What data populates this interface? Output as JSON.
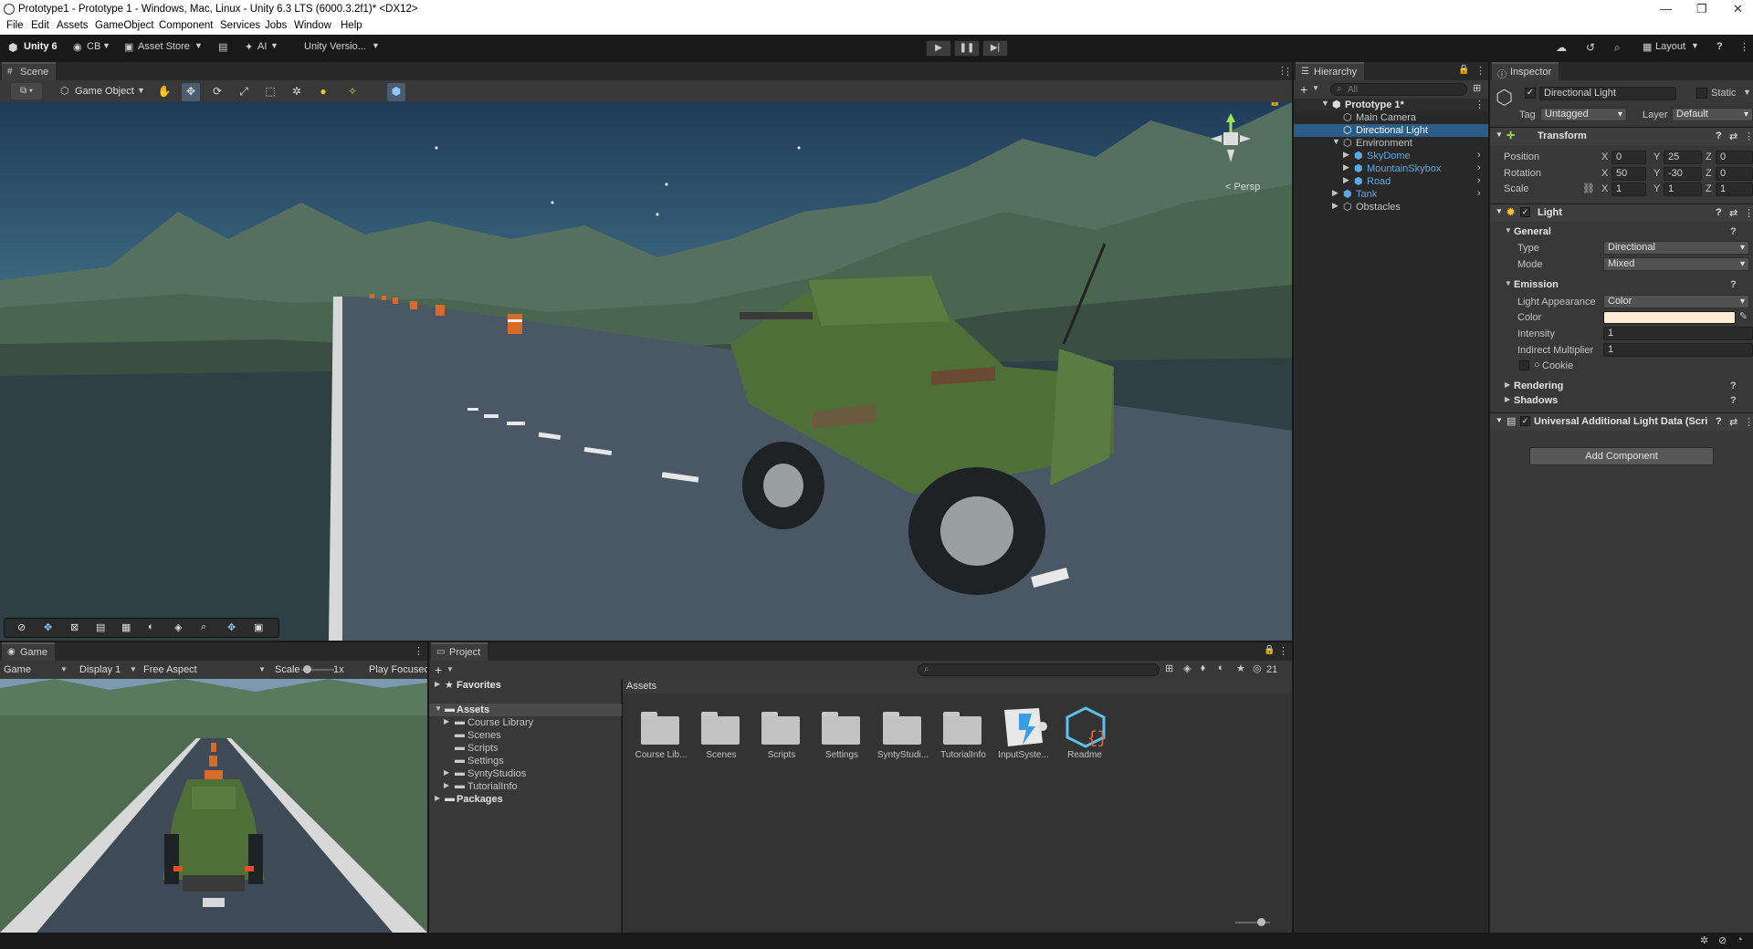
{
  "window": {
    "title": "Prototype1 - Prototype 1 - Windows, Mac, Linux - Unity 6.3 LTS (6000.3.2f1)* <DX12>",
    "controls": [
      "—",
      "❐",
      "✕"
    ]
  },
  "menu": [
    "File",
    "Edit",
    "Assets",
    "GameObject",
    "Component",
    "Services",
    "Jobs",
    "Window",
    "Help"
  ],
  "toolbar": {
    "unity_label": "Unity 6",
    "account": "CB",
    "asset_store": "Asset Store",
    "ai": "AI",
    "version": "Unity Versio...",
    "layout": "Layout"
  },
  "scene": {
    "tab": "Scene",
    "gameobject_dropdown": "Game Object",
    "persp": "< Persp"
  },
  "game": {
    "tab": "Game",
    "mode": "Game",
    "display": "Display 1",
    "aspect": "Free Aspect",
    "scale_label": "Scale",
    "scale_value": "1x",
    "play_focused": "Play Focusec"
  },
  "hierarchy": {
    "tab": "Hierarchy",
    "search_placeholder": "All",
    "scene_name": "Prototype 1*",
    "items": [
      {
        "label": "Main Camera",
        "depth": 1,
        "color": "#c4c4c4"
      },
      {
        "label": "Directional Light",
        "depth": 1,
        "color": "#ffffff",
        "selected": true
      },
      {
        "label": "Environment",
        "depth": 1,
        "color": "#c4c4c4"
      },
      {
        "label": "SkyDome",
        "depth": 2,
        "color": "#5fa8e6"
      },
      {
        "label": "MountainSkybox",
        "depth": 2,
        "color": "#5fa8e6"
      },
      {
        "label": "Road",
        "depth": 2,
        "color": "#5fa8e6"
      },
      {
        "label": "Tank",
        "depth": 1,
        "color": "#5fa8e6"
      },
      {
        "label": "Obstacles",
        "depth": 1,
        "color": "#c4c4c4"
      }
    ]
  },
  "project": {
    "tab": "Project",
    "favorites": "Favorites",
    "assets_root": "Assets",
    "tree": [
      "Course Library",
      "Scenes",
      "Scripts",
      "Settings",
      "SyntyStudios",
      "TutorialInfo"
    ],
    "packages": "Packages",
    "breadcrumb": "Assets",
    "count": "21",
    "grid": [
      "Course Lib...",
      "Scenes",
      "Scripts",
      "Settings",
      "SyntyStudi...",
      "TutorialInfo",
      "InputSyste...",
      "Readme"
    ]
  },
  "inspector": {
    "tab": "Inspector",
    "object_name": "Directional Light",
    "static": "Static",
    "tag_label": "Tag",
    "tag": "Untagged",
    "layer_label": "Layer",
    "layer": "Default",
    "transform": {
      "title": "Transform",
      "position_label": "Position",
      "rotation_label": "Rotation",
      "scale_label": "Scale",
      "position": [
        "0",
        "25",
        "0"
      ],
      "rotation": [
        "50",
        "-30",
        "0"
      ],
      "scale": [
        "1",
        "1",
        "1"
      ],
      "axes": [
        "X",
        "Y",
        "Z"
      ]
    },
    "light": {
      "title": "Light",
      "general": "General",
      "type_label": "Type",
      "type": "Directional",
      "mode_label": "Mode",
      "mode": "Mixed",
      "emission": "Emission",
      "appearance_label": "Light Appearance",
      "appearance": "Color",
      "color_label": "Color",
      "color_value": "#fcecd4",
      "intensity_label": "Intensity",
      "intensity": "1",
      "indirect_label": "Indirect Multiplier",
      "indirect": "1",
      "cookie_label": "Cookie",
      "rendering": "Rendering",
      "shadows": "Shadows"
    },
    "urp_component": "Universal Additional Light Data (Scri",
    "add_component": "Add Component"
  },
  "colors": {
    "accent_selection": "#2c5d87",
    "link_blue": "#5fa8e6"
  }
}
